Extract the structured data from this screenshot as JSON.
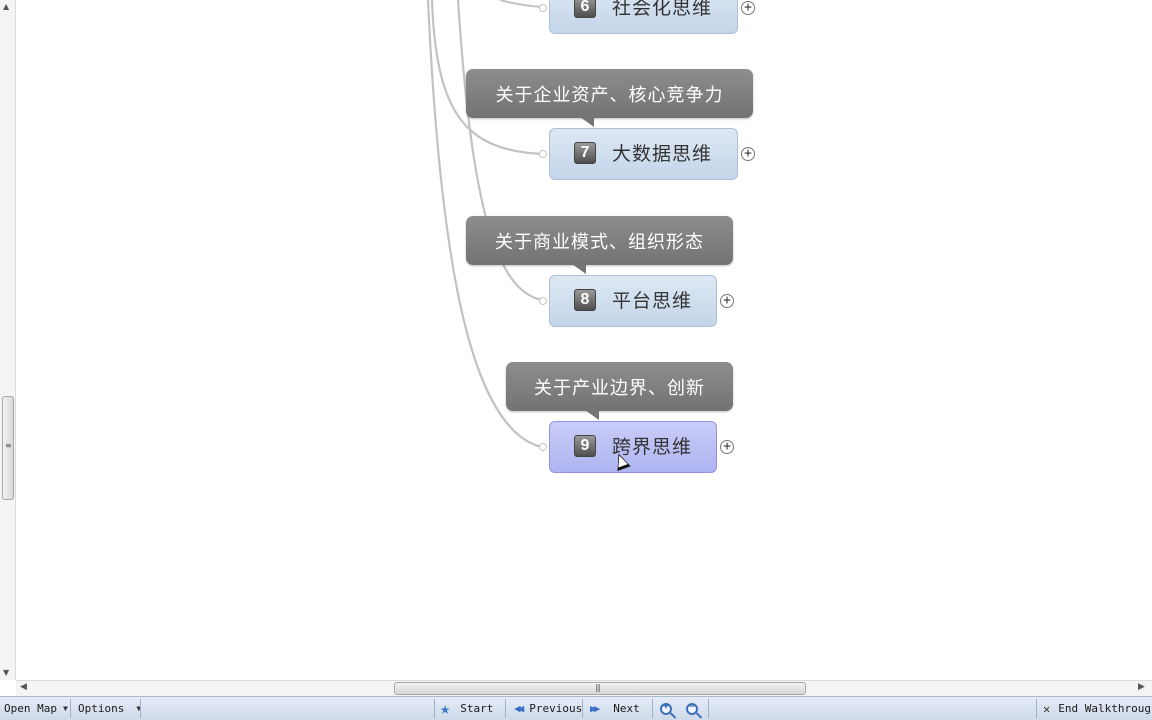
{
  "map": {
    "nodes": [
      {
        "number": "6",
        "label": "社会化思维"
      },
      {
        "number": "7",
        "label": "大数据思维"
      },
      {
        "number": "8",
        "label": "平台思维"
      },
      {
        "number": "9",
        "label": "跨界思维"
      }
    ],
    "callouts": [
      {
        "text": "关于企业资产、核心竞争力"
      },
      {
        "text": "关于商业模式、组织形态"
      },
      {
        "text": "关于产业边界、创新"
      }
    ],
    "expand_symbol": "+"
  },
  "statusbar": {
    "open_map": "Open Map",
    "options": "Options",
    "start": "Start",
    "previous": "Previous",
    "next": "Next",
    "end_walkthrough": "End Walkthrough"
  },
  "colors": {
    "node_fill": "#c4d5e9",
    "node_selected_fill": "#aeb4f0",
    "callout_fill": "#808080",
    "accent": "#3b78c7"
  }
}
